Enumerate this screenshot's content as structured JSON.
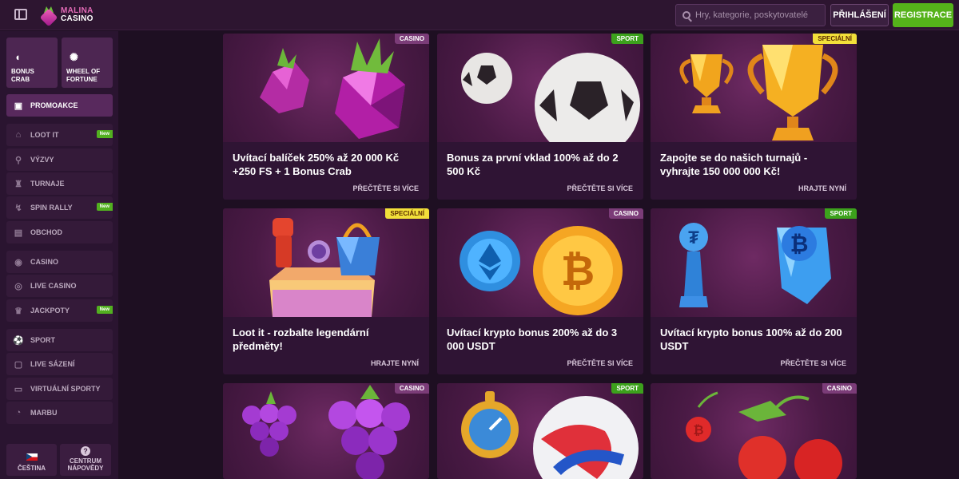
{
  "header": {
    "menu_icon": "sidebar-toggle-icon",
    "logo_line1": "MALINA",
    "logo_line2": "CASINO",
    "search_placeholder": "Hry, kategorie, poskytovatelé",
    "login_label": "PŘIHLÁŠENÍ",
    "register_label": "REGISTRACE",
    "colors": {
      "header_bg": "#2d1530",
      "register_bg": "#55b21a"
    }
  },
  "sidebar": {
    "tiles": [
      {
        "label_1": "BONUS",
        "label_2": "CRAB",
        "icon": "crab-claw-icon"
      },
      {
        "label_1": "WHEEL OF",
        "label_2": "FORTUNE",
        "icon": "wheel-icon"
      }
    ],
    "items": [
      {
        "label": "PROMOAKCE",
        "icon": "gift-icon",
        "active": true
      },
      {
        "label": "LOOT IT",
        "icon": "loot-box-icon",
        "badge": "New"
      },
      {
        "label": "VÝZVY",
        "icon": "medal-icon"
      },
      {
        "label": "TURNAJE",
        "icon": "trophy-icon"
      },
      {
        "label": "SPIN RALLY",
        "icon": "rally-icon",
        "badge": "New"
      },
      {
        "label": "OBCHOD",
        "icon": "shop-icon"
      },
      {
        "label": "CASINO",
        "icon": "casino-chip-icon"
      },
      {
        "label": "LIVE CASINO",
        "icon": "live-casino-icon"
      },
      {
        "label": "JACKPOTY",
        "icon": "jackpot-icon",
        "badge": "New"
      },
      {
        "label": "SPORT",
        "icon": "soccer-ball-icon"
      },
      {
        "label": "LIVE SÁZENÍ",
        "icon": "live-betting-icon"
      },
      {
        "label": "VIRTUÁLNÍ SPORTY",
        "icon": "virtual-sports-icon"
      },
      {
        "label": "MARBU",
        "icon": "marbu-icon"
      }
    ],
    "footer": {
      "language_label": "ČEŠTINA",
      "help_label_1": "CENTRUM",
      "help_label_2": "NÁPOVĚDY"
    }
  },
  "promos": [
    {
      "tag": "CASINO",
      "title": "Uvítací balíček 250% až 20 000 Kč +250 FS + 1 Bonus Crab",
      "link": "PŘEČTĚTE SI VÍCE",
      "art": "raspberries"
    },
    {
      "tag": "SPORT",
      "title": "Bonus za první vklad 100% až do 2 500 Kč",
      "link": "PŘEČTĚTE SI VÍCE",
      "art": "soccer-balls"
    },
    {
      "tag": "SPECIÁLNÍ",
      "title": "Zapojte se do našich turnajů - vyhrajte 150 000 000 Kč!",
      "link": "HRAJTE NYNÍ",
      "art": "trophies"
    },
    {
      "tag": "SPECIÁLNÍ",
      "title": "Loot it - rozbalte legendární předměty!",
      "link": "HRAJTE NYNÍ",
      "art": "loot-box"
    },
    {
      "tag": "CASINO",
      "title": "Uvítací krypto bonus 200% až do 3 000 USDT",
      "link": "PŘEČTĚTE SI VÍCE",
      "art": "crypto-coins"
    },
    {
      "tag": "SPORT",
      "title": "Uvítací krypto bonus 100% až do 200 USDT",
      "link": "PŘEČTĚTE SI VÍCE",
      "art": "crypto-trophy"
    },
    {
      "tag": "CASINO",
      "title": "",
      "link": "",
      "art": "grapes"
    },
    {
      "tag": "SPORT",
      "title": "",
      "link": "",
      "art": "stopwatch-ball"
    },
    {
      "tag": "CASINO",
      "title": "",
      "link": "",
      "art": "cherries"
    }
  ]
}
